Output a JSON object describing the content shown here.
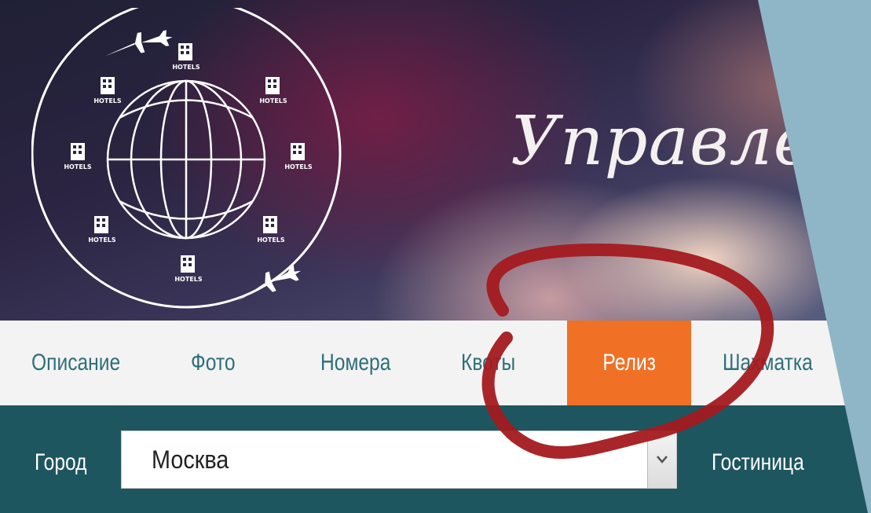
{
  "banner": {
    "title": "Управлени"
  },
  "logo": {
    "hotel_label": "HOTELS"
  },
  "nav": {
    "items": [
      {
        "label": "Описание"
      },
      {
        "label": "Фото"
      },
      {
        "label": "Номера"
      },
      {
        "label": "Квоты"
      },
      {
        "label": "Релиз"
      },
      {
        "label": "Шахматка"
      }
    ],
    "active_index": 4,
    "active_color": "#f07025"
  },
  "filter": {
    "city_label": "Город",
    "city_value": "Москва",
    "hotel_label": "Гостиница"
  },
  "colors": {
    "nav_text": "#2e6f7a",
    "filter_bar": "#1e5660",
    "annotation_circle": "#a31a1f"
  }
}
